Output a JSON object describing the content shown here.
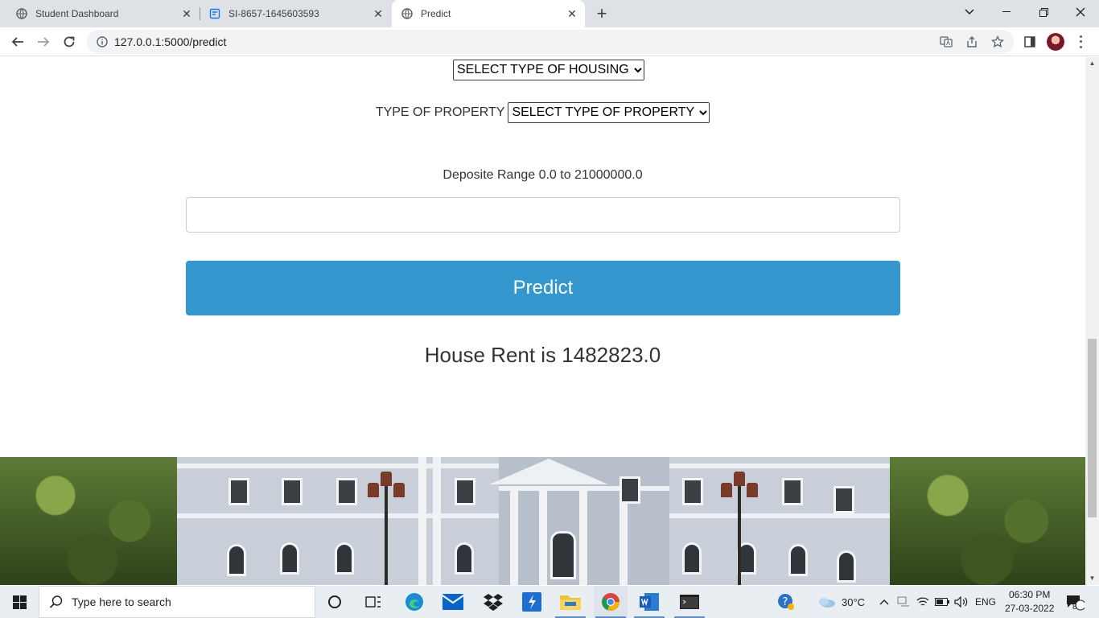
{
  "browser": {
    "tabs": [
      {
        "label": "Student Dashboard",
        "icon": "globe-icon",
        "active": false
      },
      {
        "label": "SI-8657-1645603593",
        "icon": "document-icon",
        "active": false
      },
      {
        "label": "Predict",
        "icon": "globe-icon",
        "active": true
      }
    ],
    "close_glyph": "✕",
    "new_tab_glyph": "+",
    "url": "127.0.0.1:5000/predict"
  },
  "form": {
    "housing_select": "SELECT TYPE OF HOUSING",
    "property_label": "TYPE OF PROPERTY",
    "property_select": "SELECT TYPE OF PROPERTY",
    "deposit_label": "Deposite Range 0.0 to 21000000.0",
    "deposit_value": "",
    "predict_button": "Predict",
    "result": "House Rent is 1482823.0"
  },
  "colors": {
    "predict_button": "#3498cf",
    "tab_strip": "#dee1e6",
    "taskbar": "#e9eef3"
  },
  "taskbar": {
    "search_placeholder": "Type here to search",
    "weather": "30°C",
    "language": "ENG",
    "time": "06:30 PM",
    "date": "27-03-2022",
    "notification_count": "8",
    "pinned_apps": [
      "task-view-icon",
      "edge-icon",
      "mail-icon",
      "dropbox-icon",
      "app-icon",
      "file-explorer-icon",
      "chrome-icon",
      "word-icon",
      "terminal-icon"
    ]
  }
}
